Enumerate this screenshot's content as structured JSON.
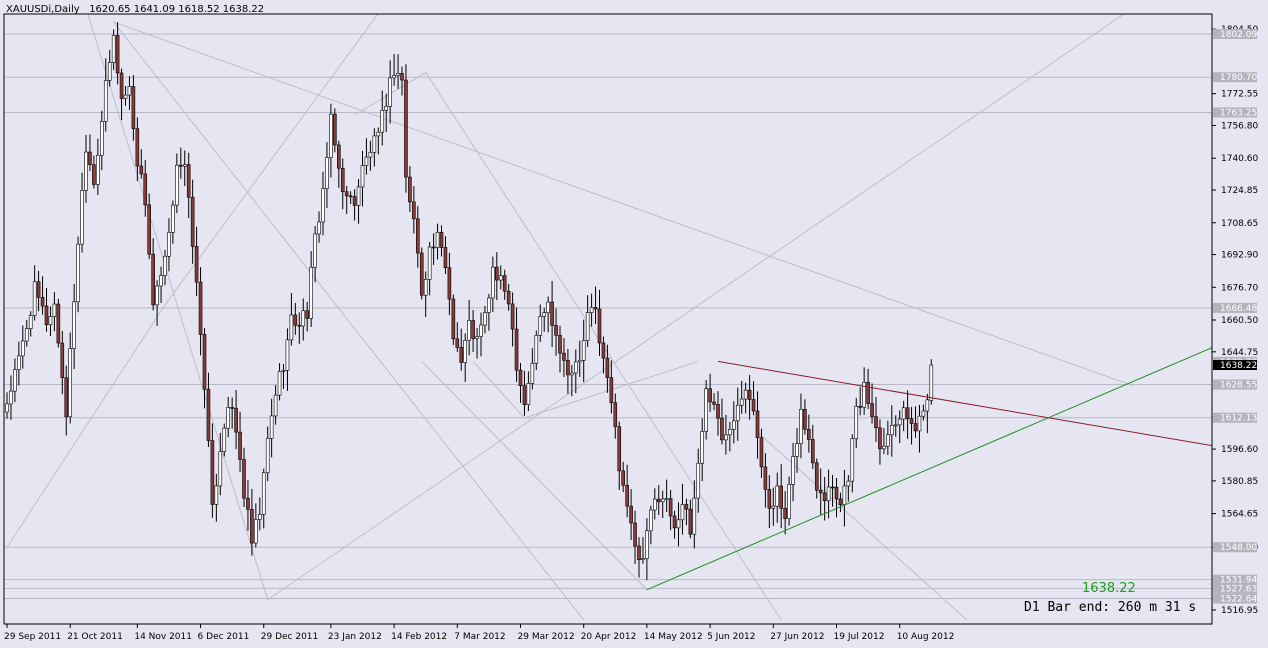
{
  "header": {
    "symbol_label": "XAUUSDi,Daily",
    "ohlc_label": "1620.65 1641.09 1618.52 1638.22"
  },
  "overlay": {
    "last_price_text": "1638.22",
    "bar_end_text": "D1 Bar end: 260 m 31 s"
  },
  "colors": {
    "background": "#E6E6F2",
    "bull": "#FFFFFF",
    "bear": "#8B3A3A",
    "grid_line": "#B8B8C8",
    "resistance_line": "#8B1A2A",
    "support_line": "#1E8C1E",
    "fan_line": "#BEBEC8"
  },
  "chart_data": {
    "type": "candlestick",
    "title": "XAUUSDi,Daily",
    "ylim": [
      1510,
      1812
    ],
    "y_ticks": [
      "1804.50",
      "1772.55",
      "1756.80",
      "1740.60",
      "1724.85",
      "1708.65",
      "1692.90",
      "1676.70",
      "1660.50",
      "1644.75",
      "1596.60",
      "1580.85",
      "1564.65",
      "1548.00",
      "1516.95"
    ],
    "price_level_tags": [
      "1802.09",
      "1780.70",
      "1763.25",
      "1666.48",
      "1639.78",
      "1628.55",
      "1612.13",
      "1548.00",
      "1531.94",
      "1527.63",
      "1522.64"
    ],
    "current_price_tag": "1638.22",
    "x_ticks": [
      {
        "label": "29 Sep 2011",
        "index": 0
      },
      {
        "label": "21 Oct 2011",
        "index": 16
      },
      {
        "label": "14 Nov 2011",
        "index": 33
      },
      {
        "label": "6 Dec 2011",
        "index": 49
      },
      {
        "label": "29 Dec 2011",
        "index": 65
      },
      {
        "label": "23 Jan 2012",
        "index": 82
      },
      {
        "label": "14 Feb 2012",
        "index": 98
      },
      {
        "label": "7 Mar 2012",
        "index": 114
      },
      {
        "label": "29 Mar 2012",
        "index": 130
      },
      {
        "label": "20 Apr 2012",
        "index": 146
      },
      {
        "label": "14 May 2012",
        "index": 162
      },
      {
        "label": "5 Jun 2012",
        "index": 178
      },
      {
        "label": "27 Jun 2012",
        "index": 194
      },
      {
        "label": "19 Jul 2012",
        "index": 210
      },
      {
        "label": "10 Aug 2012",
        "index": 226
      }
    ],
    "close_path": [
      [
        0,
        1620
      ],
      [
        3,
        1640
      ],
      [
        7,
        1675
      ],
      [
        10,
        1660
      ],
      [
        12,
        1668
      ],
      [
        15,
        1615
      ],
      [
        18,
        1700
      ],
      [
        20,
        1748
      ],
      [
        22,
        1730
      ],
      [
        25,
        1775
      ],
      [
        27,
        1800
      ],
      [
        29,
        1770
      ],
      [
        31,
        1775
      ],
      [
        33,
        1740
      ],
      [
        35,
        1720
      ],
      [
        37,
        1668
      ],
      [
        39,
        1680
      ],
      [
        41,
        1700
      ],
      [
        43,
        1740
      ],
      [
        45,
        1735
      ],
      [
        47,
        1700
      ],
      [
        50,
        1630
      ],
      [
        52,
        1565
      ],
      [
        54,
        1598
      ],
      [
        56,
        1620
      ],
      [
        58,
        1605
      ],
      [
        60,
        1575
      ],
      [
        62,
        1550
      ],
      [
        64,
        1565
      ],
      [
        66,
        1600
      ],
      [
        68,
        1625
      ],
      [
        70,
        1640
      ],
      [
        72,
        1660
      ],
      [
        74,
        1660
      ],
      [
        76,
        1665
      ],
      [
        78,
        1700
      ],
      [
        80,
        1725
      ],
      [
        82,
        1758
      ],
      [
        84,
        1735
      ],
      [
        86,
        1720
      ],
      [
        88,
        1720
      ],
      [
        90,
        1735
      ],
      [
        92,
        1745
      ],
      [
        94,
        1750
      ],
      [
        96,
        1770
      ],
      [
        98,
        1785
      ],
      [
        100,
        1780
      ],
      [
        101,
        1730
      ],
      [
        103,
        1710
      ],
      [
        105,
        1675
      ],
      [
        107,
        1695
      ],
      [
        109,
        1700
      ],
      [
        111,
        1688
      ],
      [
        113,
        1655
      ],
      [
        115,
        1640
      ],
      [
        117,
        1658
      ],
      [
        119,
        1650
      ],
      [
        121,
        1662
      ],
      [
        123,
        1685
      ],
      [
        125,
        1678
      ],
      [
        127,
        1672
      ],
      [
        129,
        1640
      ],
      [
        131,
        1620
      ],
      [
        133,
        1640
      ],
      [
        135,
        1662
      ],
      [
        137,
        1668
      ],
      [
        139,
        1655
      ],
      [
        141,
        1640
      ],
      [
        143,
        1635
      ],
      [
        145,
        1640
      ],
      [
        147,
        1662
      ],
      [
        149,
        1665
      ],
      [
        151,
        1640
      ],
      [
        153,
        1620
      ],
      [
        155,
        1590
      ],
      [
        157,
        1570
      ],
      [
        159,
        1545
      ],
      [
        161,
        1540
      ],
      [
        163,
        1565
      ],
      [
        165,
        1575
      ],
      [
        167,
        1570
      ],
      [
        169,
        1560
      ],
      [
        171,
        1570
      ],
      [
        173,
        1555
      ],
      [
        175,
        1590
      ],
      [
        177,
        1625
      ],
      [
        179,
        1620
      ],
      [
        181,
        1600
      ],
      [
        183,
        1610
      ],
      [
        185,
        1620
      ],
      [
        187,
        1630
      ],
      [
        189,
        1618
      ],
      [
        191,
        1585
      ],
      [
        193,
        1570
      ],
      [
        195,
        1575
      ],
      [
        197,
        1560
      ],
      [
        199,
        1590
      ],
      [
        201,
        1615
      ],
      [
        203,
        1600
      ],
      [
        205,
        1580
      ],
      [
        207,
        1575
      ],
      [
        209,
        1580
      ],
      [
        211,
        1570
      ],
      [
        213,
        1585
      ],
      [
        215,
        1615
      ],
      [
        217,
        1626
      ],
      [
        219,
        1615
      ],
      [
        221,
        1600
      ],
      [
        223,
        1605
      ],
      [
        225,
        1610
      ],
      [
        227,
        1620
      ],
      [
        229,
        1605
      ],
      [
        231,
        1612
      ],
      [
        233,
        1620
      ],
      [
        234,
        1638.22
      ]
    ],
    "last_candle": {
      "open": 1620.65,
      "high": 1641.09,
      "low": 1618.52,
      "close": 1638.22
    },
    "levels": [
      1802.09,
      1780.7,
      1763.25,
      1666.48,
      1628.55,
      1612.13,
      1548.0,
      1531.94,
      1527.63,
      1522.64
    ],
    "trendlines": {
      "resistance": [
        [
          180,
          1640
        ],
        [
          285,
          1605
        ]
      ],
      "support": [
        [
          162,
          1527
        ],
        [
          285,
          1630
        ]
      ]
    },
    "fan_lines": [
      [
        [
          27,
          1808
        ],
        [
          285,
          1628
        ]
      ],
      [
        [
          27,
          1808
        ],
        [
          146,
          1512
        ]
      ],
      [
        [
          66,
          1522
        ],
        [
          285,
          1815
        ]
      ],
      [
        [
          66,
          1522
        ],
        [
          20,
          1815
        ]
      ],
      [
        [
          40,
          1668
        ],
        [
          0,
          1548
        ]
      ],
      [
        [
          40,
          1668
        ],
        [
          95,
          1815
        ]
      ],
      [
        [
          106,
          1783
        ],
        [
          196,
          1512
        ]
      ],
      [
        [
          106,
          1783
        ],
        [
          88,
          1762
        ]
      ],
      [
        [
          131,
          1612
        ],
        [
          175,
          1640
        ]
      ],
      [
        [
          131,
          1612
        ],
        [
          118,
          1640
        ]
      ],
      [
        [
          162,
          1527
        ],
        [
          105,
          1640
        ]
      ],
      [
        [
          190,
          1605
        ],
        [
          243,
          1512
        ]
      ]
    ],
    "grid": false,
    "legend": "none"
  }
}
